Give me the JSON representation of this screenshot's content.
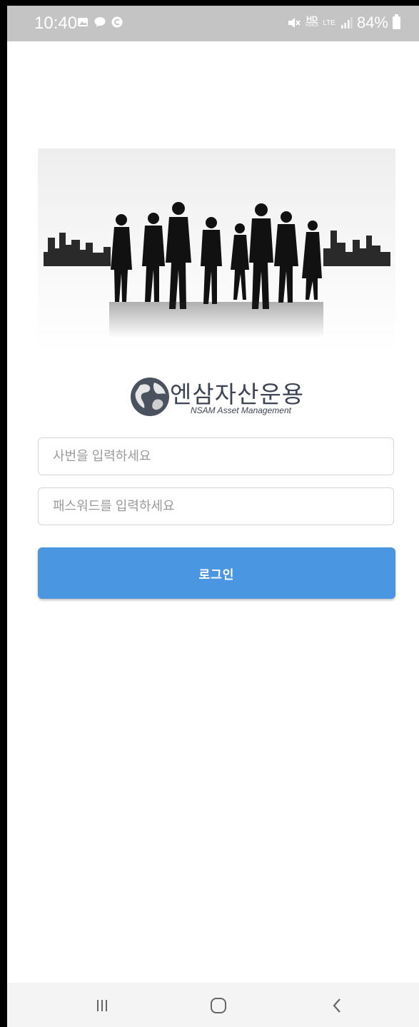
{
  "status_bar": {
    "time": "10:40",
    "hd_label": "HD",
    "hd_sub": "VOICE",
    "lte_label": "LTE",
    "battery": "84%",
    "icons": [
      "gallery-icon",
      "chat-icon",
      "c-app-icon",
      "mute-icon",
      "signal-icon",
      "battery-icon"
    ]
  },
  "hero": {
    "icon": "business-people-skyline-image"
  },
  "logo": {
    "title": "엔삼자산운용",
    "subtitle": "NSAM Asset Management",
    "icon": "globe-icon"
  },
  "form": {
    "id_placeholder": "사번을 입력하세요",
    "id_value": "",
    "pw_placeholder": "패스워드를 입력하세요",
    "pw_value": "",
    "login_label": "로그인",
    "accent_color": "#4a96e0"
  },
  "nav": {
    "icons": [
      "recents-icon",
      "home-icon",
      "back-icon"
    ]
  }
}
